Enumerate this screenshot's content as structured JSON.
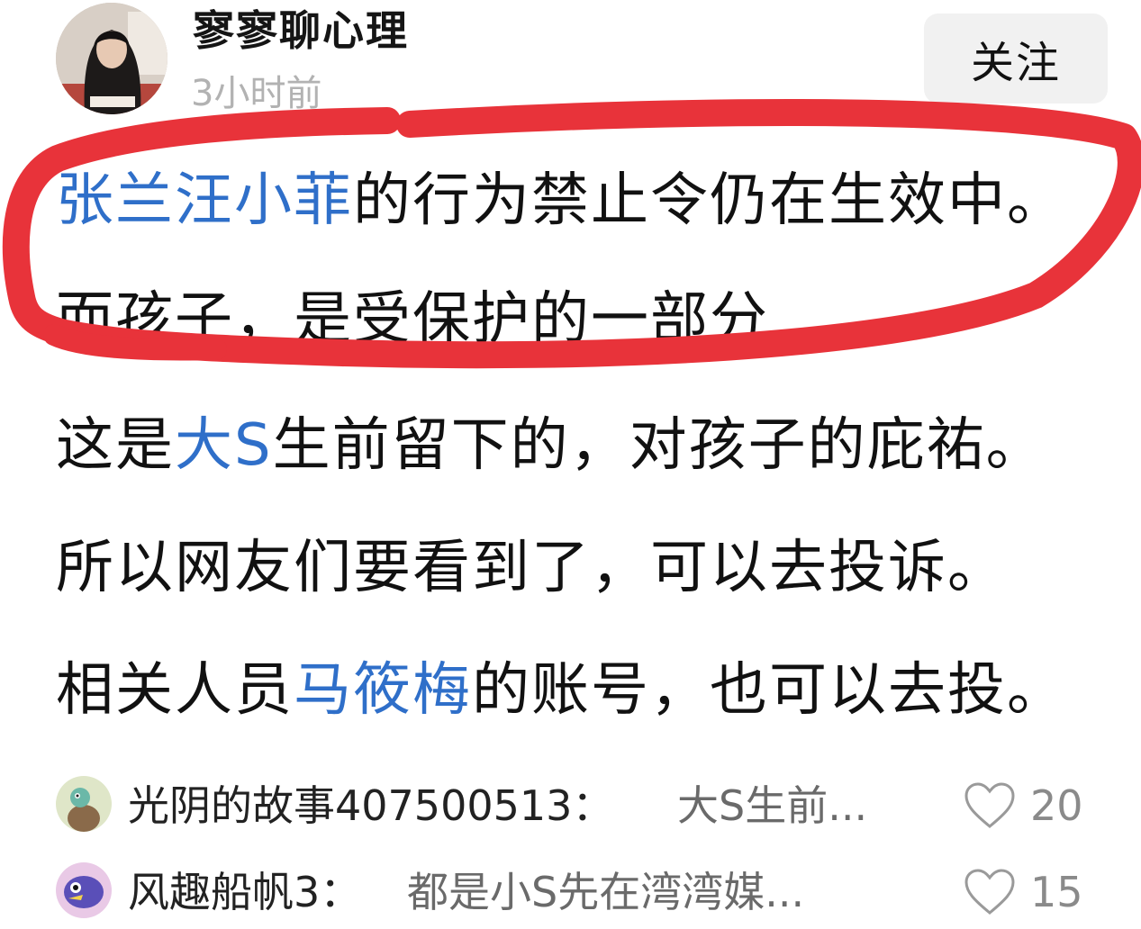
{
  "header": {
    "username": "寥寥聊心理",
    "time": "3小时前",
    "follow_label": "关注"
  },
  "post": {
    "line1": {
      "mention": "张兰汪小菲",
      "text": "的行为禁止令仍在生效中。"
    },
    "line2": {
      "text": "而孩子，是受保护的一部分"
    },
    "line3": {
      "pre": "这是",
      "mention": "大S",
      "post": "生前留下的，对孩子的庇祐。"
    },
    "line4": {
      "text": "所以网友们要看到了，可以去投诉。"
    },
    "line5": {
      "pre": "相关人员",
      "mention": "马筱梅",
      "post": "的账号，也可以去投。"
    }
  },
  "comments": [
    {
      "name": "光阴的故事407500513：",
      "text": "大S生前...",
      "likes": "20"
    },
    {
      "name": "风趣船帆3：",
      "text": "都是小S先在湾湾媒...",
      "likes": "15"
    }
  ],
  "colors": {
    "mention": "#2f6fc9",
    "annotation": "#e8333a",
    "follow_bg": "#f1f1f1"
  },
  "icons": {
    "like": "heart-outline-icon"
  }
}
